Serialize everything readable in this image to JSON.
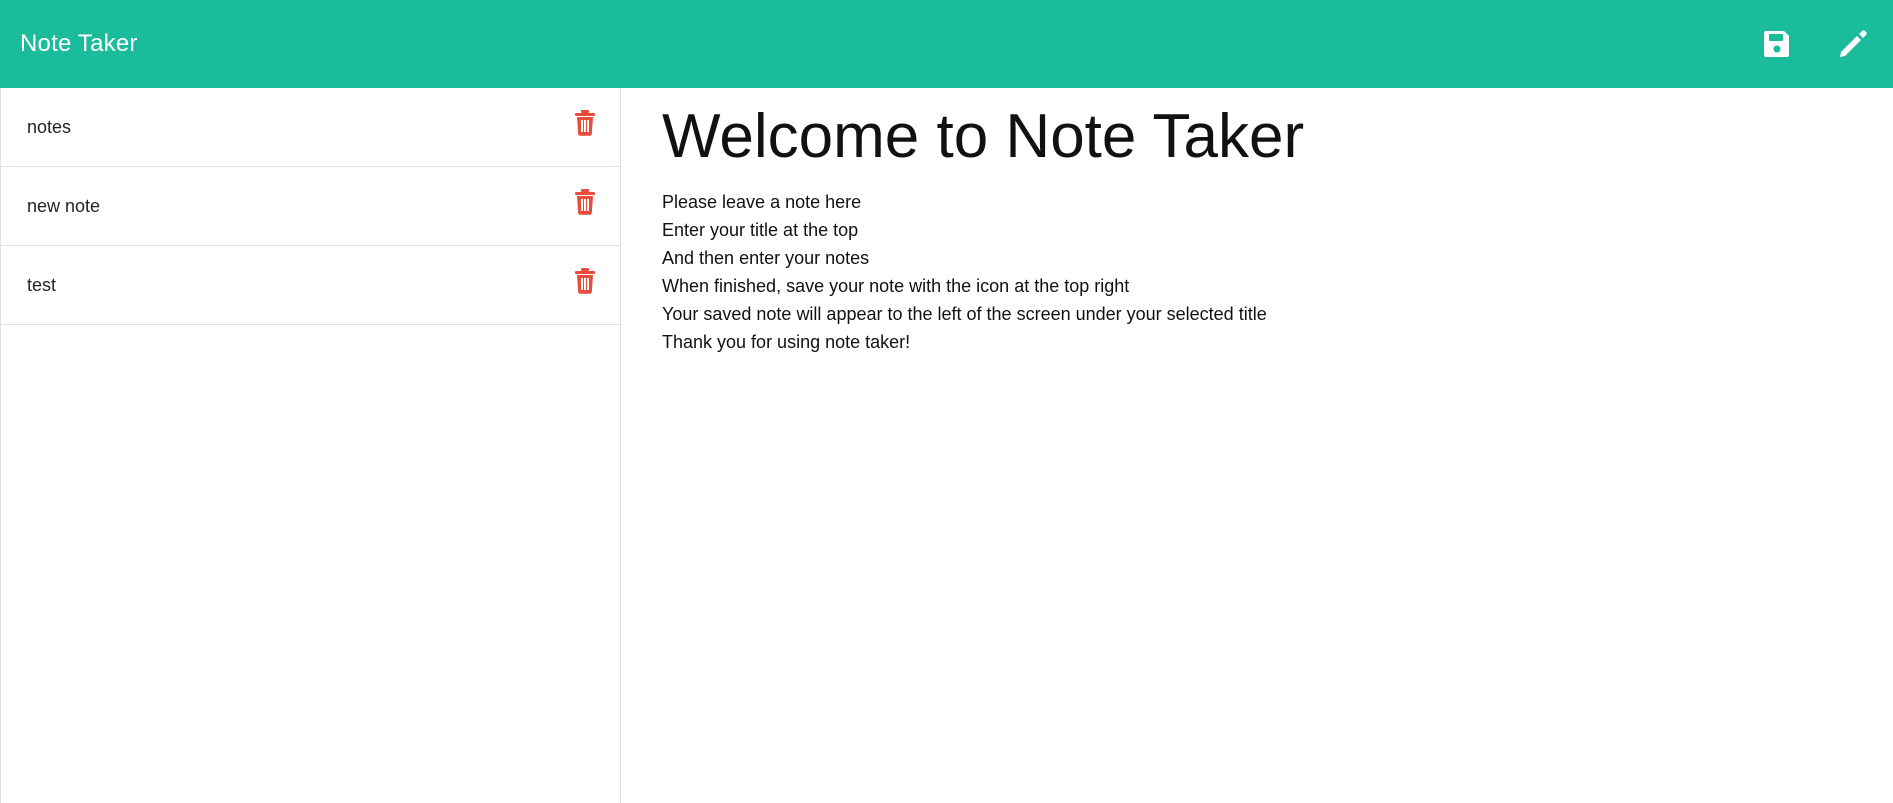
{
  "app": {
    "brand": "Note Taker",
    "accent_color": "#1abc9c",
    "icons": {
      "save": "floppy-disk-icon",
      "new": "pencil-icon",
      "delete": "trash-icon"
    }
  },
  "sidebar": {
    "items": [
      {
        "label": "notes"
      },
      {
        "label": "new note"
      },
      {
        "label": "test"
      }
    ]
  },
  "main": {
    "title": "Welcome to Note Taker",
    "lines": [
      "Please leave a note here",
      "Enter your title at the top",
      "And then enter your notes",
      "When finished, save your note with the icon at the top right",
      "Your saved note will appear to the left of the screen under your selected title",
      "Thank you for using note taker!"
    ]
  }
}
